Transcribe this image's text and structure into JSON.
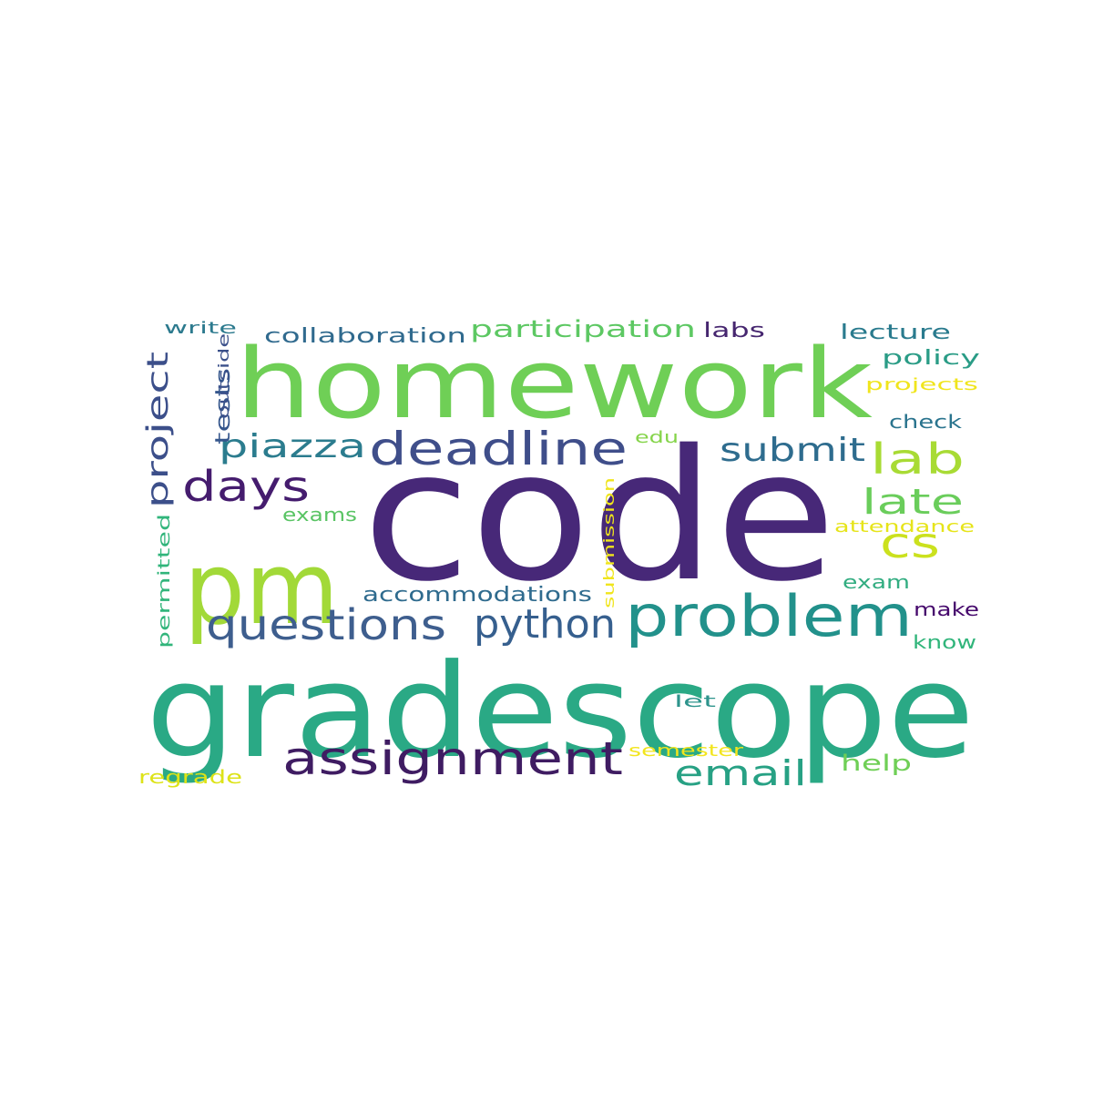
{
  "word_cloud": {
    "words": [
      {
        "text": "code",
        "color": "#472878"
      },
      {
        "text": "gradescope",
        "color": "#2aa985"
      },
      {
        "text": "homework",
        "color": "#6fcf56"
      },
      {
        "text": "pm",
        "color": "#a2d938"
      },
      {
        "text": "problem",
        "color": "#22918b"
      },
      {
        "text": "assignment",
        "color": "#3f1c62"
      },
      {
        "text": "deadline",
        "color": "#3f4e8a"
      },
      {
        "text": "questions",
        "color": "#3e5e8e"
      },
      {
        "text": "days",
        "color": "#451c6e"
      },
      {
        "text": "python",
        "color": "#365f8e"
      },
      {
        "text": "lab",
        "color": "#a8db34"
      },
      {
        "text": "cs",
        "color": "#cbe11e"
      },
      {
        "text": "late",
        "color": "#6acd5b"
      },
      {
        "text": "email",
        "color": "#27a184"
      },
      {
        "text": "submit",
        "color": "#2e6c8e"
      },
      {
        "text": "piazza",
        "color": "#2b7c8e"
      },
      {
        "text": "project",
        "color": "#3c4f8a"
      },
      {
        "text": "participation",
        "color": "#5dc863"
      },
      {
        "text": "collaboration",
        "color": "#306a8e"
      },
      {
        "text": "accommodations",
        "color": "#2f6b8e"
      },
      {
        "text": "lecture",
        "color": "#2a7b8e"
      },
      {
        "text": "policy",
        "color": "#2a9c86"
      },
      {
        "text": "labs",
        "color": "#46266f"
      },
      {
        "text": "tests",
        "color": "#35568c"
      },
      {
        "text": "write",
        "color": "#2c7a8e"
      },
      {
        "text": "outside",
        "color": "#3b508a"
      },
      {
        "text": "projects",
        "color": "#f0e51c"
      },
      {
        "text": "check",
        "color": "#2a748e"
      },
      {
        "text": "edu",
        "color": "#85d44a"
      },
      {
        "text": "attendance",
        "color": "#e6e41a"
      },
      {
        "text": "exams",
        "color": "#59c464"
      },
      {
        "text": "exam",
        "color": "#32ad81"
      },
      {
        "text": "make",
        "color": "#46086c"
      },
      {
        "text": "know",
        "color": "#31b57b"
      },
      {
        "text": "permitted",
        "color": "#31b57b"
      },
      {
        "text": "submission",
        "color": "#f0e51c"
      },
      {
        "text": "let",
        "color": "#2e948c"
      },
      {
        "text": "semester",
        "color": "#f2e51d"
      },
      {
        "text": "regrade",
        "color": "#dde318"
      },
      {
        "text": "help",
        "color": "#6fcf56"
      }
    ]
  }
}
